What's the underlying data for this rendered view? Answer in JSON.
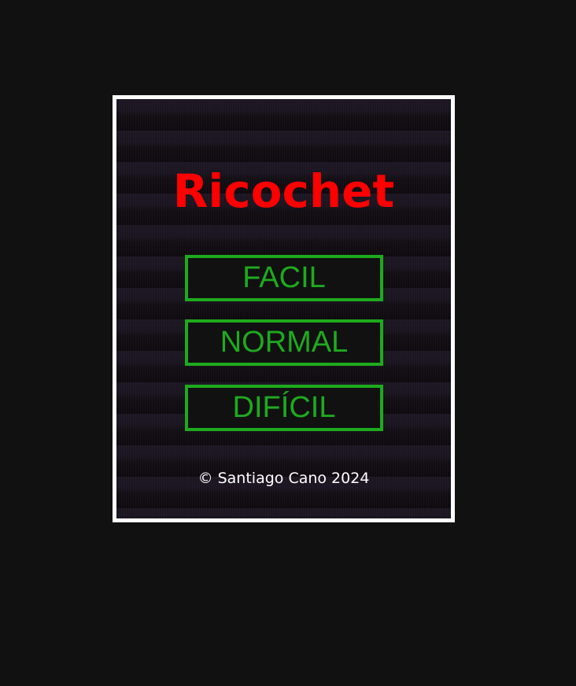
{
  "game": {
    "title": "Ricochet",
    "buttons": {
      "easy": "FACIL",
      "normal": "NORMAL",
      "hard": "DIFÍCIL"
    },
    "copyright": "© Santiago Cano 2024"
  },
  "colors": {
    "page_background": "#111111",
    "frame_border": "#ffffff",
    "title": "#ff0000",
    "button_accent": "#1eaa1e",
    "copyright_text": "#ffffff"
  }
}
